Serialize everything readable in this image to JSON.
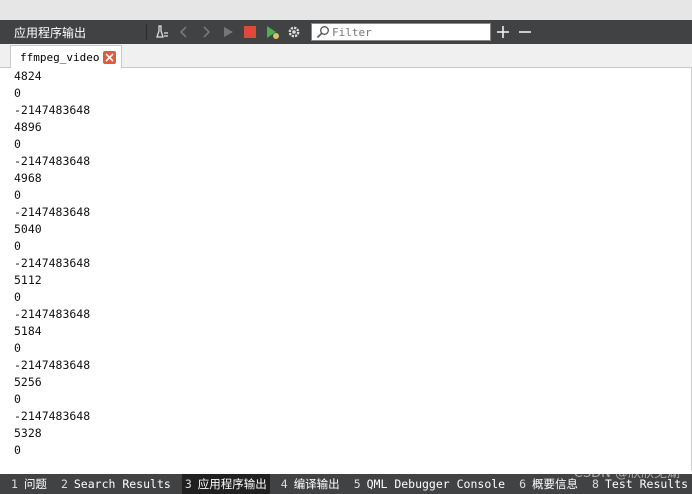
{
  "toolbar": {
    "title": "应用程序输出",
    "filter_placeholder": "Filter",
    "icons": [
      "clean-output-icon",
      "previous-icon",
      "next-icon",
      "run-icon",
      "stop-icon",
      "debug-run-icon",
      "settings-icon",
      "search-icon",
      "zoom-in-icon",
      "zoom-out-icon"
    ]
  },
  "tab": {
    "label": "ffmpeg_video"
  },
  "output": {
    "lines": [
      "4824",
      "0",
      "-2147483648",
      "4896",
      "0",
      "-2147483648",
      "4968",
      "0",
      "-2147483648",
      "5040",
      "0",
      "-2147483648",
      "5112",
      "0",
      "-2147483648",
      "5184",
      "0",
      "-2147483648",
      "5256",
      "0",
      "-2147483648",
      "5328",
      "0"
    ]
  },
  "statusbar": {
    "items": [
      {
        "num": "1",
        "label": "问题"
      },
      {
        "num": "2",
        "label": "Search Results"
      },
      {
        "num": "3",
        "label": "应用程序输出"
      },
      {
        "num": "4",
        "label": "编译输出"
      },
      {
        "num": "5",
        "label": "QML Debugger Console"
      },
      {
        "num": "6",
        "label": "概要信息"
      },
      {
        "num": "8",
        "label": "Test Results"
      }
    ],
    "active_index": 2
  },
  "watermark": "CSDN @欣欣芜湖",
  "colors": {
    "toolbar_bg": "#404244",
    "stop_red": "#e0483b",
    "run_green": "#4caf50",
    "close_orange": "#e05a3b"
  }
}
